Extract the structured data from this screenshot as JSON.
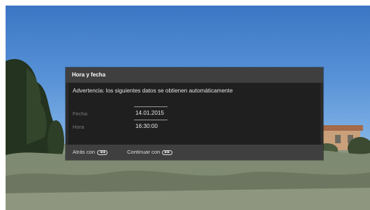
{
  "dialog": {
    "title": "Hora y fecha",
    "warning": "Advertencia: los siguientes datos se obtienen automáticamente",
    "fields": [
      {
        "label": "Fecha",
        "value": "14.01.2015"
      },
      {
        "label": "Hora",
        "value": "16:30:00"
      }
    ],
    "footer": {
      "back_label": "Atrás con",
      "back_icon": "rewind-button-icon",
      "continue_label": "Continuar con",
      "continue_icon": "fast-forward-button-icon"
    }
  },
  "colors": {
    "dialog_header": "#3f3f3f",
    "dialog_body": "#1f1f1f",
    "sky": "#4f8ad2"
  }
}
